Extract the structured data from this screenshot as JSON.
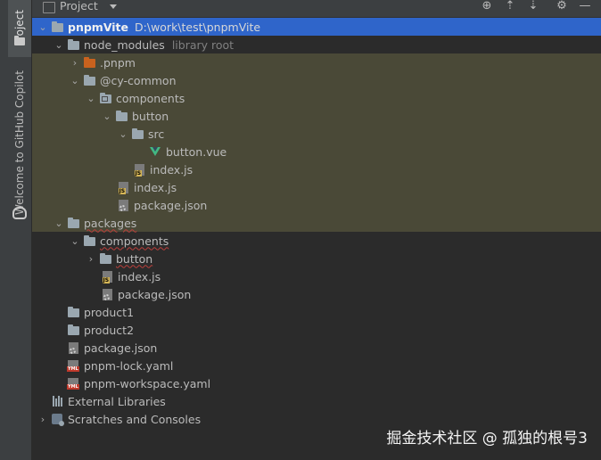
{
  "sidebar": {
    "project_tab": "Project",
    "copilot_tab": "Welcome to GitHub Copilot"
  },
  "header": {
    "title": "Project",
    "toolbar_icons": [
      "target-icon",
      "collapse-all-icon",
      "expand-all-icon",
      "gear-icon",
      "minimize-icon"
    ]
  },
  "tree": {
    "root": {
      "label": "pnpmVite",
      "path": "D:\\work\\test\\pnpmVite"
    },
    "node_modules": {
      "label": "node_modules",
      "hint": "library root"
    },
    "pnpm_dir": "pnpm",
    "pnpm_prefix": ".",
    "cy_common": "@cy-common",
    "nm_components": "components",
    "nm_button": "button",
    "nm_src": "src",
    "nm_button_vue": "button.vue",
    "nm_button_index": "index.js",
    "nm_cy_index": "index.js",
    "nm_cy_package": "package.json",
    "packages": "packages",
    "pk_components": "components",
    "pk_button": "button",
    "pk_index": "index.js",
    "pk_package": "package.json",
    "product1": "product1",
    "product2": "product2",
    "root_package": "package.json",
    "lock": "pnpm-lock.yaml",
    "workspace": "pnpm-workspace.yaml",
    "external": "External Libraries",
    "scratches": "Scratches and Consoles"
  },
  "colors": {
    "selection": "#2f65ca",
    "library_highlight": "#4a4937",
    "vue": "#42b883"
  },
  "watermark": "掘金技术社区 @ 孤独的根号3"
}
